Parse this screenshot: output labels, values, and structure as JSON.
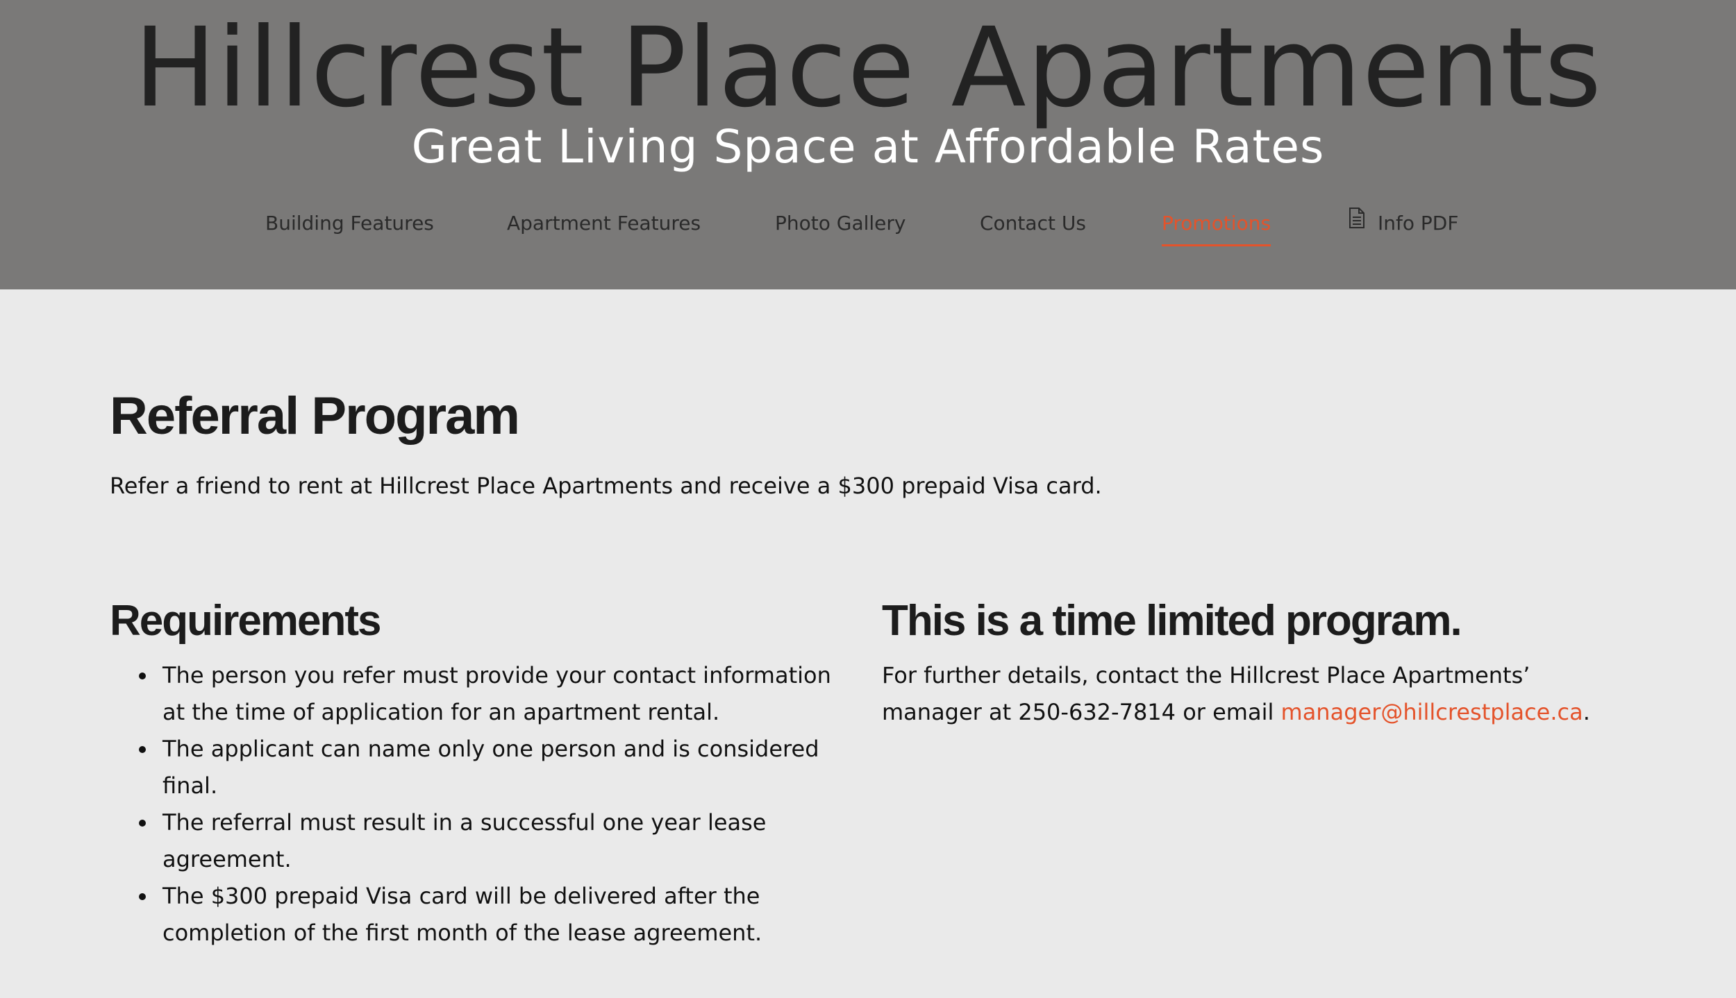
{
  "header": {
    "title": "Hillcrest Place Apartments",
    "tagline": "Great Living Space at Affordable Rates"
  },
  "nav": {
    "items": [
      {
        "label": "Building Features"
      },
      {
        "label": "Apartment Features"
      },
      {
        "label": "Photo Gallery"
      },
      {
        "label": "Contact Us"
      },
      {
        "label": "Promotions",
        "active": true
      },
      {
        "label": "Info PDF",
        "icon": "document-icon"
      }
    ]
  },
  "main": {
    "heading": "Referral Program",
    "intro": "Refer a friend to rent at Hillcrest Place Apartments and receive a $300 prepaid Visa card.",
    "requirements": {
      "heading": "Requirements",
      "items": [
        "The person you refer must provide your contact information at the time of application for an apartment rental.",
        "The applicant can name only one person and is considered final.",
        "The referral must result in a successful one year lease agreement.",
        "The $300 prepaid Visa card will be delivered after the completion of the first month of the lease agreement."
      ]
    },
    "limited": {
      "heading": "This is a time limited program.",
      "text_before": "For further details, contact the Hillcrest Place Apartments’ manager at 250-632-7814 or email ",
      "email": "manager@hillcrestplace.ca",
      "text_after": "."
    }
  },
  "colors": {
    "header_bg": "#7a7978",
    "page_bg": "#eaeaea",
    "accent": "#e4532b",
    "title": "#222222",
    "tagline": "#ffffff"
  }
}
